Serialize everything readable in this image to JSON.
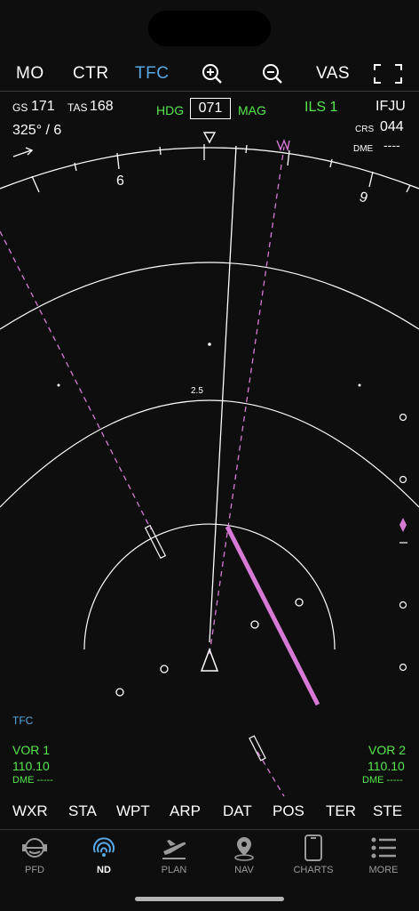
{
  "topbar": {
    "mo": "MO",
    "ctr": "CTR",
    "tfc": "TFC",
    "zoom_in_icon": "zoom-in-icon",
    "zoom_out_icon": "zoom-out-icon",
    "vas": "VAS",
    "fullscreen_icon": "fullscreen-icon"
  },
  "info": {
    "gs_label": "GS",
    "gs_value": "171",
    "tas_label": "TAS",
    "tas_value": "168",
    "wind": "325° / 6",
    "hdg_label": "HDG",
    "hdg_value": "071",
    "mag_label": "MAG",
    "ils_label": "ILS 1",
    "ident": "IFJU",
    "crs_label": "CRS",
    "crs_value": "044",
    "dme_label": "DME",
    "dme_value": "----"
  },
  "compass": {
    "label_6": "6",
    "label_9": "9"
  },
  "range": {
    "ring_label": "2.5"
  },
  "nav": {
    "tfc_label": "TFC",
    "vor1_label": "VOR 1",
    "vor1_freq": "110.10",
    "vor1_dme": "DME -----",
    "vor2_label": "VOR 2",
    "vor2_freq": "110.10",
    "vor2_dme": "DME -----"
  },
  "lowbar": [
    "WXR",
    "STA",
    "WPT",
    "ARP",
    "DAT",
    "POS",
    "TER",
    "STE"
  ],
  "tabs": [
    {
      "label": "PFD",
      "icon": "pfd-icon"
    },
    {
      "label": "ND",
      "icon": "nd-icon"
    },
    {
      "label": "PLAN",
      "icon": "plane-icon"
    },
    {
      "label": "NAV",
      "icon": "location-pin-icon"
    },
    {
      "label": "CHARTS",
      "icon": "phone-icon"
    },
    {
      "label": "MORE",
      "icon": "list-icon"
    }
  ],
  "colors": {
    "accent_blue": "#58a8e6",
    "green": "#55e84b",
    "magenta": "#d77ad6",
    "background": "#0e0e0e"
  }
}
